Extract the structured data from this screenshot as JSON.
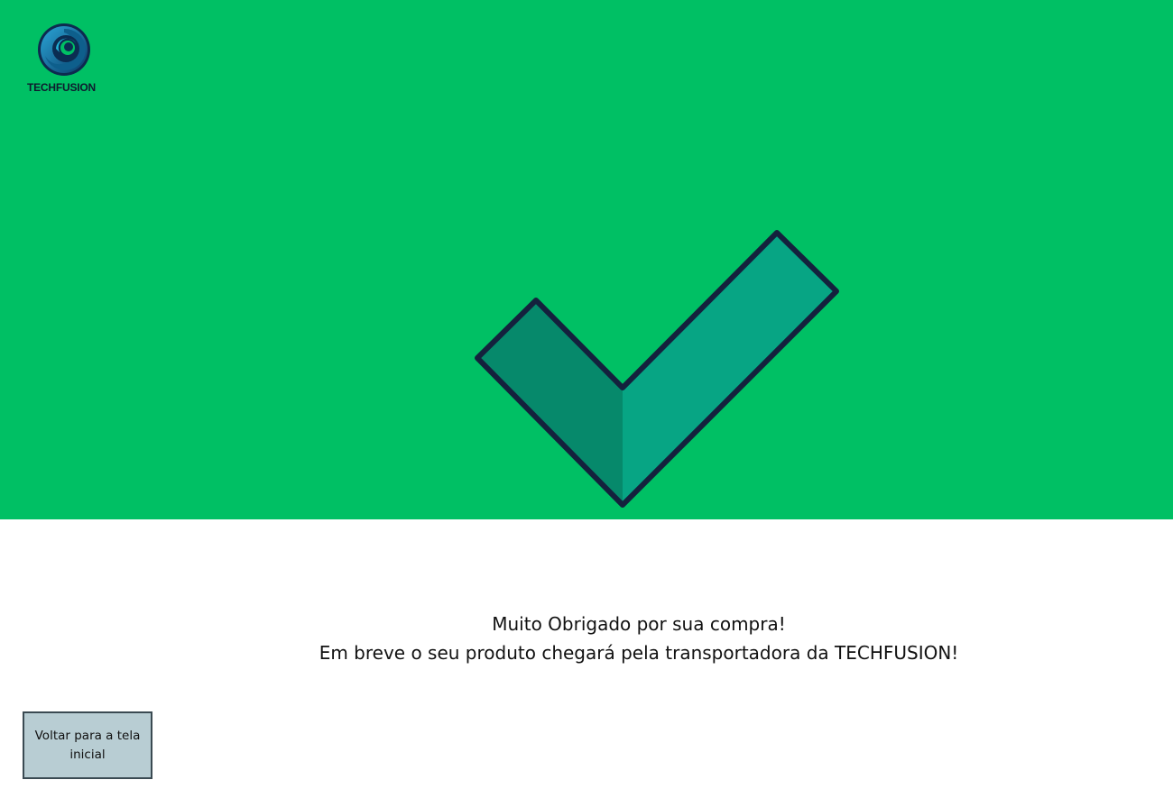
{
  "colors": {
    "hero_background": "#00c064",
    "check_left_face": "#06896b",
    "check_right_face": "#07a584",
    "check_outline": "#14213d",
    "button_background": "#b8cdd3",
    "button_border": "#3a4a52"
  },
  "brand": {
    "logo_icon": "techfusion-swirl-logo",
    "logo_text": "TECHFUSION"
  },
  "hero": {
    "icon": "checkmark-icon"
  },
  "message": {
    "line1": "Muito Obrigado por sua compra!",
    "line2": "Em breve o seu produto chegará pela transportadora da TECHFUSION!"
  },
  "actions": {
    "back_label": "Voltar para a tela inicial"
  }
}
